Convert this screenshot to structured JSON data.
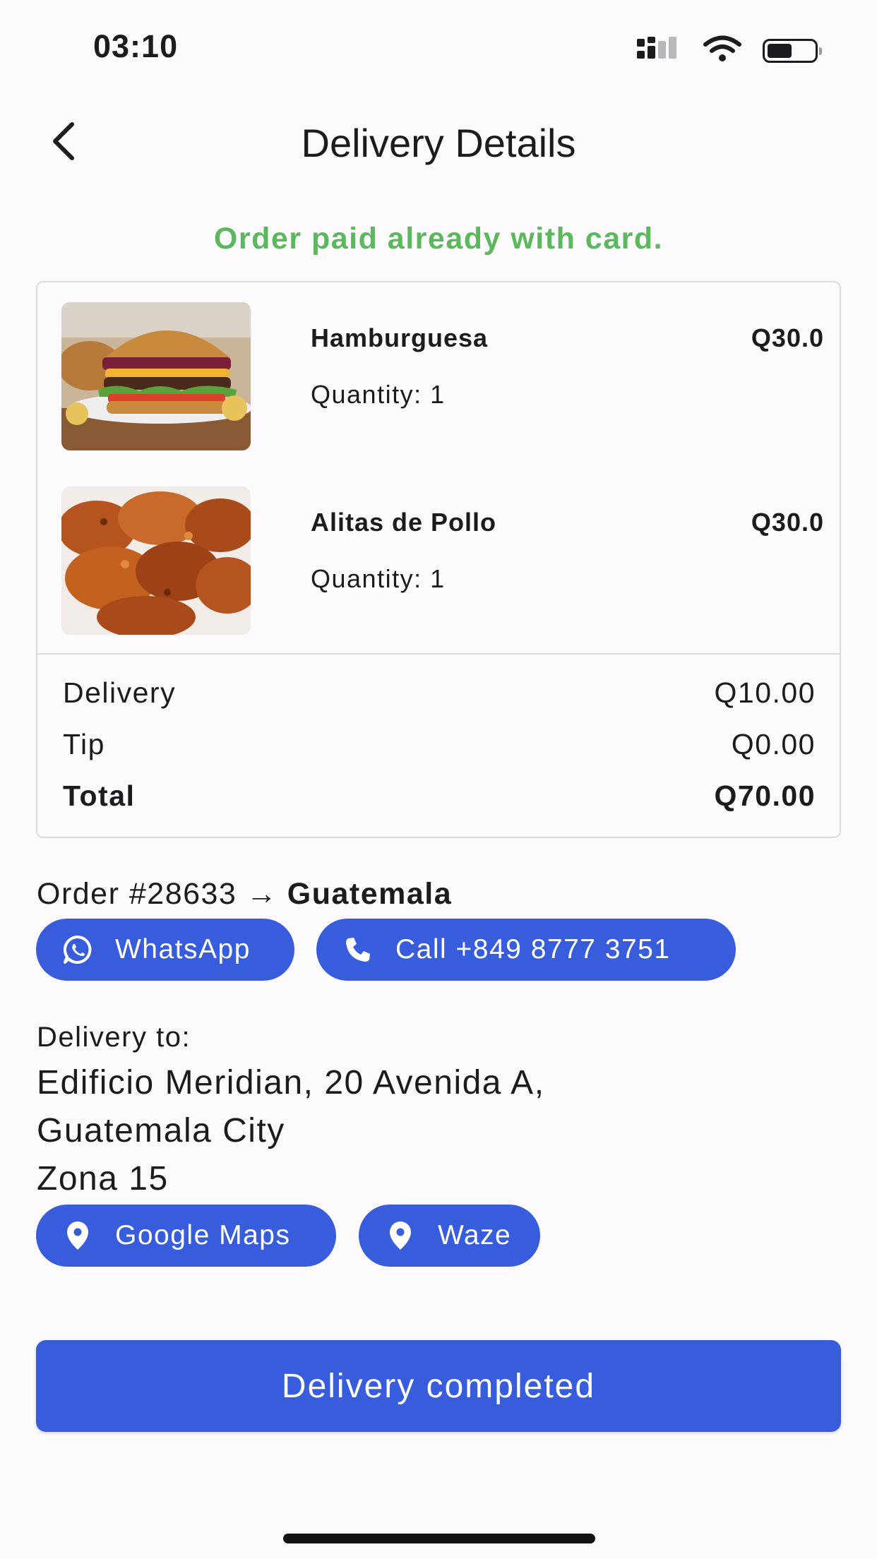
{
  "status_bar": {
    "time": "03:10",
    "icons": [
      "cellular-signal-icon",
      "wifi-icon",
      "battery-icon"
    ]
  },
  "header": {
    "title": "Delivery Details",
    "back_icon": "chevron-left-icon"
  },
  "payment_note": "Order paid already with card.",
  "order": {
    "items": [
      {
        "name": "Hamburguesa",
        "price": "Q30.0",
        "quantity": "Quantity: 1",
        "image": "hamburger-photo"
      },
      {
        "name": "Alitas de Pollo",
        "price": "Q30.0",
        "quantity": "Quantity: 1",
        "image": "chicken-wings-photo"
      }
    ],
    "summary": {
      "delivery_label": "Delivery",
      "delivery_value": "Q10.00",
      "tip_label": "Tip",
      "tip_value": "Q0.00",
      "total_label": "Total",
      "total_value": "Q70.00"
    }
  },
  "order_info": {
    "prefix": "Order #28633 →",
    "destination": "Guatemala"
  },
  "contact": {
    "whatsapp_label": "WhatsApp",
    "call_label": "Call +849 8777 3751"
  },
  "delivery": {
    "label": "Delivery to:",
    "address_lines": [
      "Edificio Meridian, 20 Avenida A,",
      "Guatemala City",
      "Zona 15"
    ]
  },
  "navigation": {
    "google_maps_label": "Google Maps",
    "waze_label": "Waze"
  },
  "actions": {
    "complete_label": "Delivery completed"
  },
  "colors": {
    "primary": "#385ddc",
    "success": "#5cb85c",
    "background": "#fcfafd",
    "text": "#1d1b20"
  }
}
